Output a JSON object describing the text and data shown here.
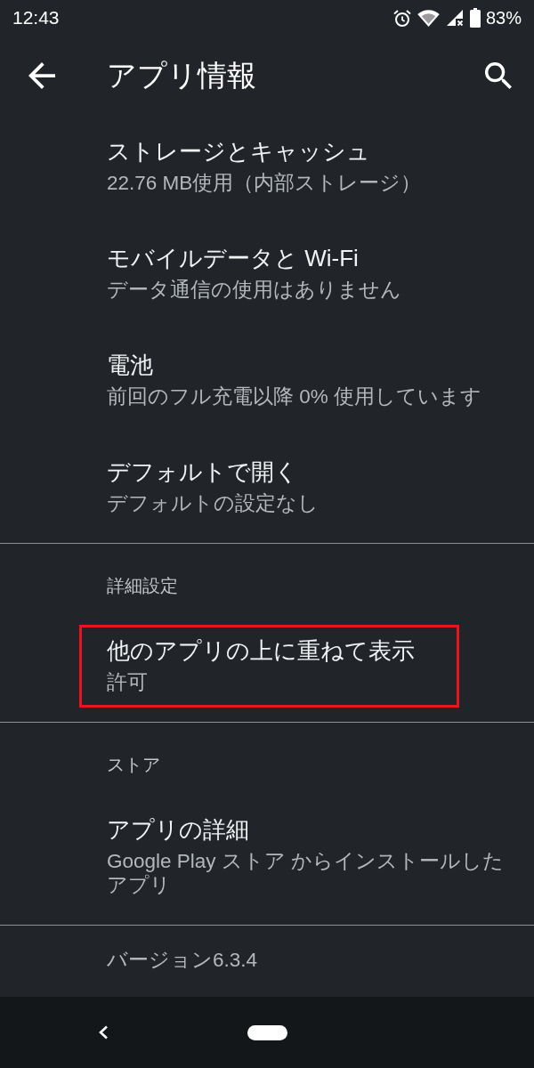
{
  "status_bar": {
    "time": "12:43",
    "battery": "83%"
  },
  "app_bar": {
    "title": "アプリ情報"
  },
  "sections": [
    {
      "items": [
        {
          "title": "ストレージとキャッシュ",
          "summary": "22.76 MB使用（内部ストレージ）",
          "highlighted": false
        },
        {
          "title": "モバイルデータと Wi-Fi",
          "summary": "データ通信の使用はありません",
          "highlighted": false
        },
        {
          "title": "電池",
          "summary": "前回のフル充電以降 0% 使用しています",
          "highlighted": false
        },
        {
          "title": "デフォルトで開く",
          "summary": "デフォルトの設定なし",
          "highlighted": false
        }
      ]
    },
    {
      "header": "詳細設定",
      "items": [
        {
          "title": "他のアプリの上に重ねて表示",
          "summary": "許可",
          "highlighted": true
        }
      ]
    },
    {
      "header": "ストア",
      "items": [
        {
          "title": "アプリの詳細",
          "summary": "Google Play ストア からインストールしたアプリ",
          "highlighted": false
        }
      ]
    }
  ],
  "version": "バージョン6.3.4"
}
